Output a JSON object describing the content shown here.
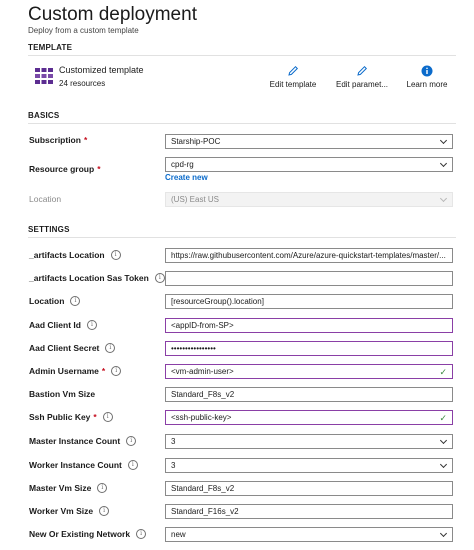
{
  "header": {
    "title": "Custom deployment",
    "subtitle": "Deploy from a custom template"
  },
  "template_section": {
    "heading": "TEMPLATE",
    "name": "Customized template",
    "resources": "24 resources",
    "icon": "template-grid-icon",
    "actions": [
      {
        "label": "Edit template",
        "icon": "pencil-icon"
      },
      {
        "label": "Edit paramet...",
        "icon": "pencil-icon"
      },
      {
        "label": "Learn more",
        "icon": "info-icon"
      }
    ]
  },
  "basics": {
    "heading": "BASICS",
    "subscription": {
      "label": "Subscription",
      "value": "Starship-POC"
    },
    "resource_group": {
      "label": "Resource group",
      "value": "cpd-rg",
      "create_new": "Create new"
    },
    "location": {
      "label": "Location",
      "value": "(US) East US"
    }
  },
  "settings": {
    "heading": "SETTINGS",
    "artifacts_location": {
      "label": "_artifacts Location",
      "value": "https://raw.githubusercontent.com/Azure/azure-quickstart-templates/master/..."
    },
    "artifacts_sas": {
      "label": "_artifacts Location Sas Token",
      "value": ""
    },
    "location": {
      "label": "Location",
      "value": "[resourceGroup().location]"
    },
    "aad_client_id": {
      "label": "Aad Client Id",
      "value": "<appID-from-SP>"
    },
    "aad_client_secret": {
      "label": "Aad Client Secret",
      "value": "••••••••••••••••"
    },
    "admin_username": {
      "label": "Admin Username",
      "value": "<vm-admin-user>"
    },
    "bastion_vm_size": {
      "label": "Bastion Vm Size",
      "value": "Standard_F8s_v2"
    },
    "ssh_public_key": {
      "label": "Ssh Public Key",
      "value": "<ssh-public-key>"
    },
    "master_count": {
      "label": "Master Instance Count",
      "value": "3"
    },
    "worker_count": {
      "label": "Worker Instance Count",
      "value": "3"
    },
    "master_vm_size": {
      "label": "Master Vm Size",
      "value": "Standard_F8s_v2"
    },
    "worker_vm_size": {
      "label": "Worker Vm Size",
      "value": "Standard_F16s_v2"
    },
    "network": {
      "label": "New Or Existing Network",
      "value": "new"
    }
  },
  "colors": {
    "accent": "#0b6bcb",
    "required": "#c50f1f",
    "highlight_border": "#8a3fa6",
    "valid_check": "#3c8a3f",
    "template_icon": "#5c2d91"
  }
}
